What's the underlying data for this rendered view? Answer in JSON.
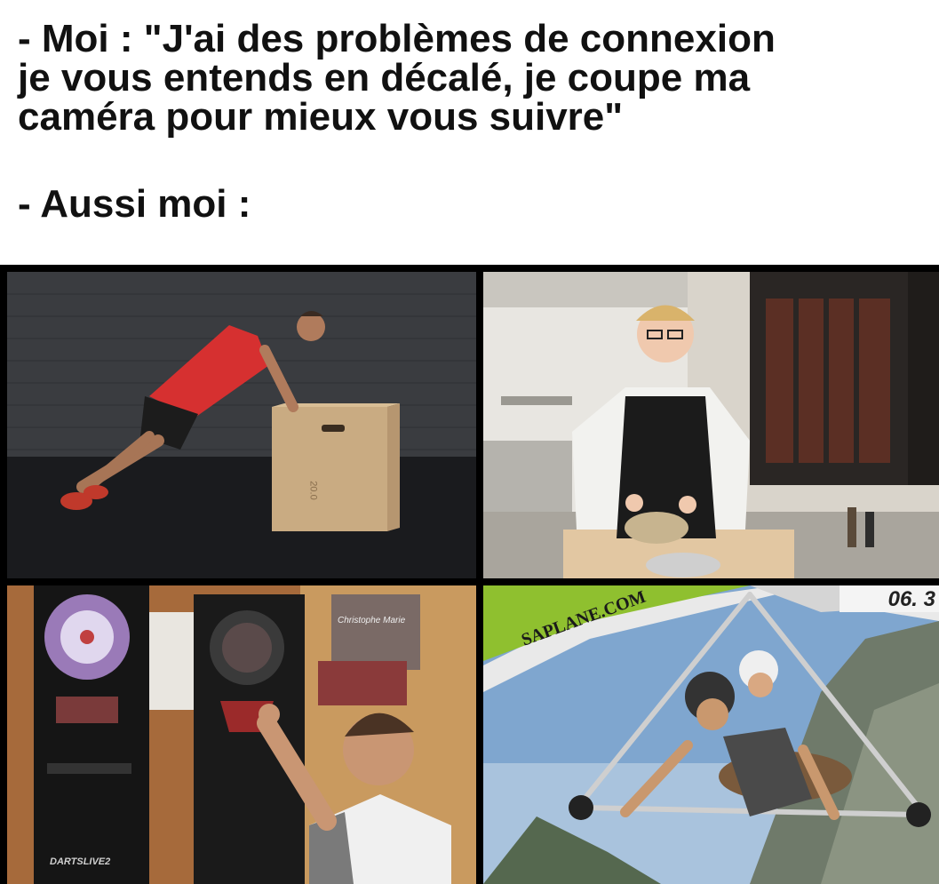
{
  "caption": {
    "line1": "- Moi : \"J'ai des problèmes de connexion",
    "line2": "je vous entends en décalé, je coupe ma",
    "line3": "caméra pour mieux vous suivre\"",
    "line4": "- Aussi moi :"
  },
  "panels": {
    "box_label": "20.0",
    "darts_brand": "DARTSLIVE2",
    "poster_name": "Christophe Marie",
    "glider_banner": "SAPLANE.COM",
    "glider_timestamp": "06. 3"
  }
}
